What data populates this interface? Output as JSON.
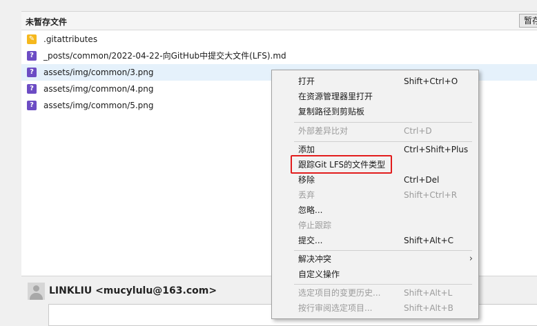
{
  "section": {
    "title": "未暂存文件",
    "stash_button": "暂存"
  },
  "files": [
    {
      "name": ".gitattributes",
      "status": "modified",
      "icon": "pencil-icon"
    },
    {
      "name": "_posts/common/2022-04-22-向GitHub中提交大文件(LFS).md",
      "status": "untracked",
      "icon": "question-icon"
    },
    {
      "name": "assets/img/common/3.png",
      "status": "untracked",
      "icon": "question-icon",
      "selected": true
    },
    {
      "name": "assets/img/common/4.png",
      "status": "untracked",
      "icon": "question-icon"
    },
    {
      "name": "assets/img/common/5.png",
      "status": "untracked",
      "icon": "question-icon"
    }
  ],
  "commit": {
    "author": "LINKLIU <mucylulu@163.com>"
  },
  "context_menu": {
    "open": {
      "label": "打开",
      "shortcut": "Shift+Ctrl+O"
    },
    "open_in_explorer": {
      "label": "在资源管理器里打开"
    },
    "copy_path": {
      "label": "复制路径到剪贴板"
    },
    "external_diff": {
      "label": "外部差异比对",
      "shortcut": "Ctrl+D"
    },
    "add": {
      "label": "添加",
      "shortcut": "Ctrl+Shift+Plus"
    },
    "track_lfs": {
      "label": "跟踪Git LFS的文件类型"
    },
    "remove": {
      "label": "移除",
      "shortcut": "Ctrl+Del"
    },
    "discard": {
      "label": "丢弃",
      "shortcut": "Shift+Ctrl+R"
    },
    "ignore": {
      "label": "忽略..."
    },
    "stop_tracking": {
      "label": "停止跟踪"
    },
    "commit": {
      "label": "提交...",
      "shortcut": "Shift+Alt+C"
    },
    "resolve_conflict": {
      "label": "解决冲突"
    },
    "custom_action": {
      "label": "自定义操作"
    },
    "history": {
      "label": "选定项目的变更历史...",
      "shortcut": "Shift+Alt+L"
    },
    "annotate": {
      "label": "按行审阅选定项目...",
      "shortcut": "Shift+Alt+B"
    }
  },
  "colors": {
    "highlight_box": "#e21b1b",
    "modified_icon": "#f5b81d",
    "untracked_icon": "#6c4cc4",
    "selected_row": "#e5f1fb"
  }
}
